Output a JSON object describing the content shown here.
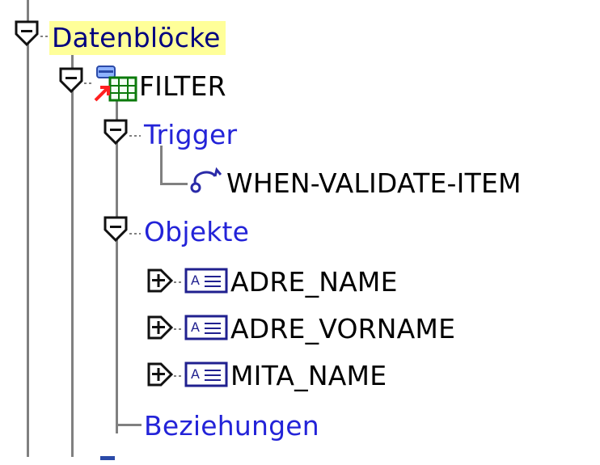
{
  "tree": {
    "datenbloecke": {
      "label": "Datenblöcke",
      "selected": true
    },
    "filter_block": {
      "label": "FILTER"
    },
    "trigger_group": {
      "label": "Trigger"
    },
    "trigger_item": {
      "label": "WHEN-VALIDATE-ITEM"
    },
    "objekte_group": {
      "label": "Objekte"
    },
    "items": [
      {
        "label": "ADRE_NAME"
      },
      {
        "label": "ADRE_VORNAME"
      },
      {
        "label": "MITA_NAME"
      }
    ],
    "beziehungen_group": {
      "label": "Beziehungen"
    }
  },
  "colors": {
    "selected_bg": "#ffff99",
    "group_text": "#2323d8",
    "item_text": "#000000",
    "tree_lines": "#808080"
  },
  "icons": {
    "collapse": "minus-expander-icon",
    "expand": "plus-expander-icon",
    "block": "data-block-icon",
    "trigger": "trigger-icon",
    "text_item": "text-item-icon"
  }
}
